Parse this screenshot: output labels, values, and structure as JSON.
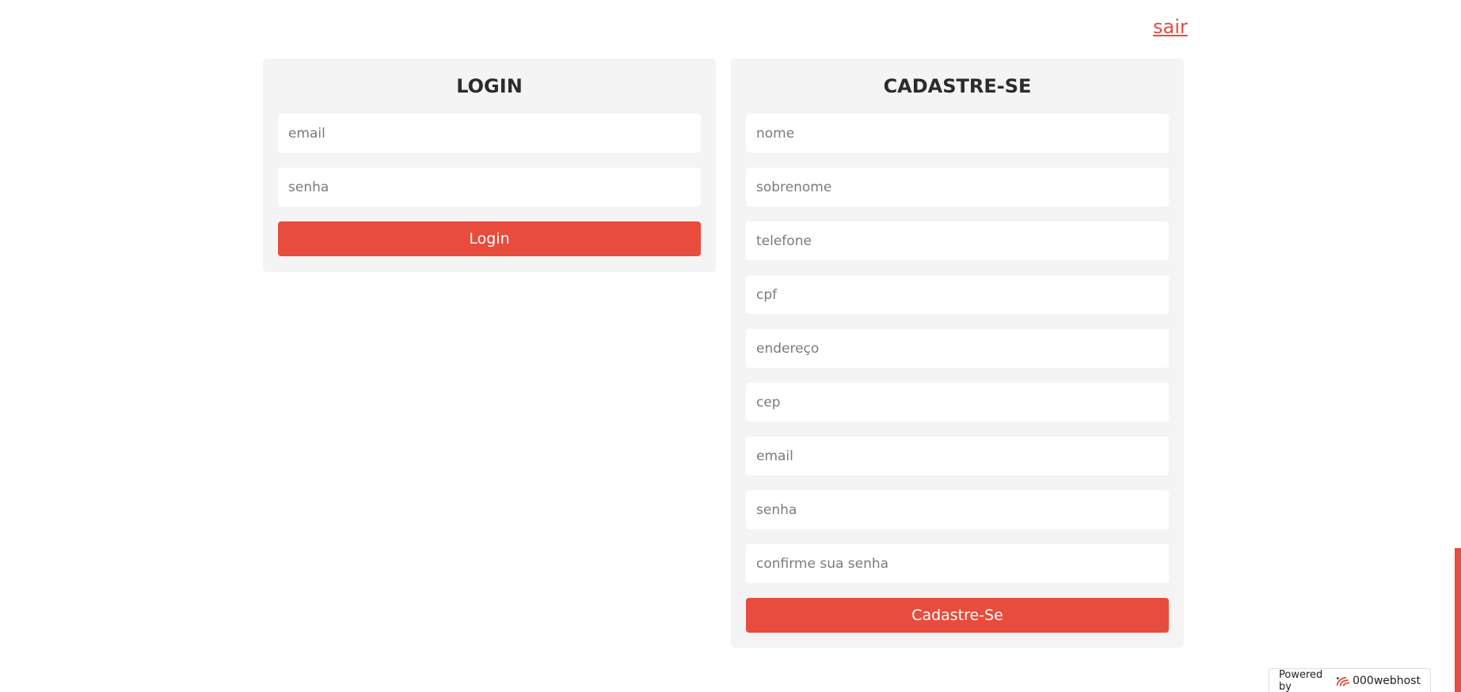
{
  "header": {
    "logout_label": "sair"
  },
  "login": {
    "title": "LOGIN",
    "email_placeholder": "email",
    "password_placeholder": "senha",
    "submit_label": "Login"
  },
  "signup": {
    "title": "CADASTRE-SE",
    "first_name_placeholder": "nome",
    "last_name_placeholder": "sobrenome",
    "phone_placeholder": "telefone",
    "cpf_placeholder": "cpf",
    "address_placeholder": "endereço",
    "cep_placeholder": "cep",
    "email_placeholder": "email",
    "password_placeholder": "senha",
    "confirm_password_placeholder": "confirme sua senha",
    "submit_label": "Cadastre-Se"
  },
  "badge": {
    "prefix": "Powered by",
    "brand": "000webhost",
    "icon": "000webhost-logo-icon"
  },
  "colors": {
    "accent": "#e74c3c",
    "panel_bg": "#f4f4f4",
    "title_text": "#2b2b2b"
  }
}
